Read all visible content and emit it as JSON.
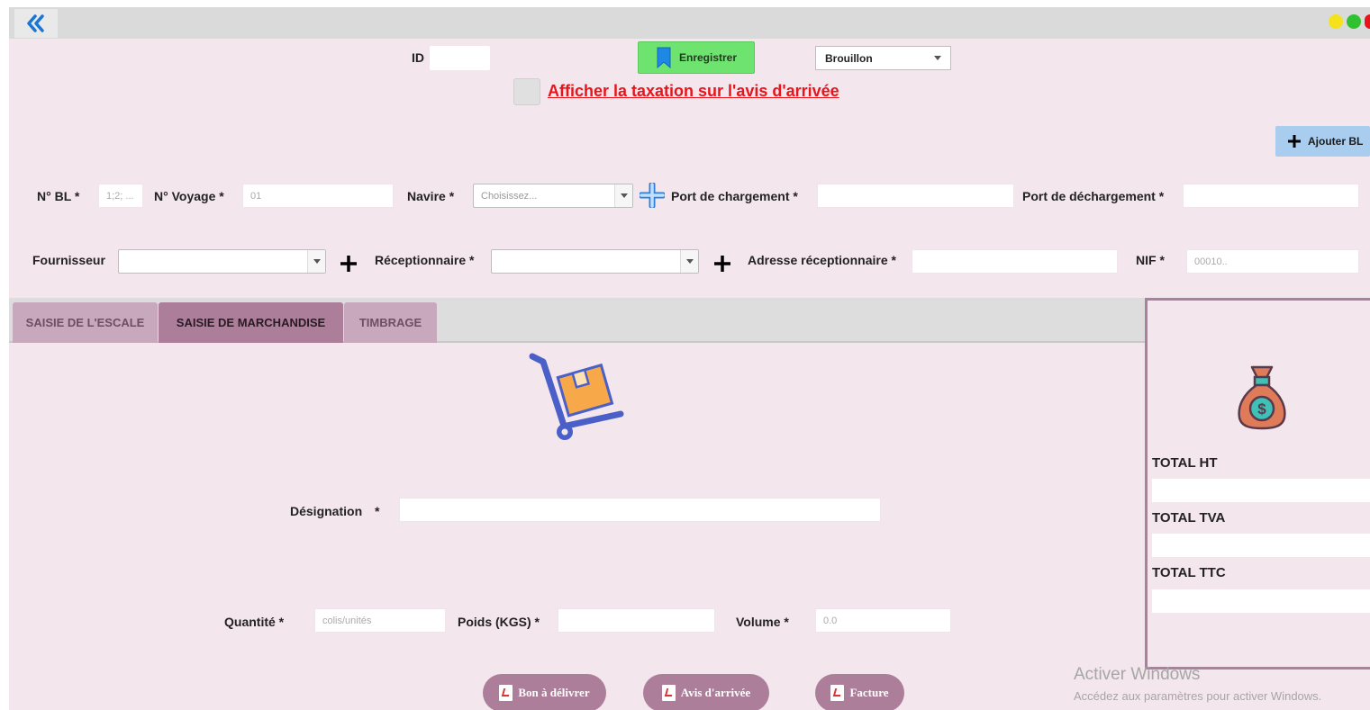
{
  "header": {
    "id_label": "ID",
    "id_value": "",
    "save_label": "Enregistrer",
    "status_value": "Brouillon",
    "tax_checkbox_label": "Afficher la taxation sur l'avis d'arrivée",
    "add_bl_label": "Ajouter BL"
  },
  "window_controls": {
    "colors": [
      "#f4e31a",
      "#2fc12f",
      "#e8141b"
    ]
  },
  "form": {
    "bl_label": "N° BL *",
    "bl_placeholder": "1;2; ...",
    "voyage_label": "N° Voyage *",
    "voyage_placeholder": "01",
    "navire_label": "Navire *",
    "navire_placeholder": "Choisissez...",
    "port_chargement_label": "Port de chargement *",
    "port_dechargement_label": "Port de déchargement *",
    "fournisseur_label": "Fournisseur",
    "receptionnaire_label": "Réceptionnaire *",
    "adresse_label": "Adresse réceptionnaire *",
    "nif_label": "NIF *",
    "nif_placeholder": "00010.."
  },
  "tabs": [
    {
      "label": "SAISIE DE L'ESCALE",
      "active": false
    },
    {
      "label": "SAISIE DE MARCHANDISE",
      "active": true
    },
    {
      "label": "TIMBRAGE",
      "active": false
    }
  ],
  "marchandise": {
    "designation_label": "Désignation",
    "designation_required": "*",
    "quantite_label": "Quantité *",
    "quantite_placeholder": "colis/unités",
    "poids_label": "Poids (KGS) *",
    "volume_label": "Volume *",
    "volume_placeholder": "0.0"
  },
  "totals": {
    "ht_label": "TOTAL HT",
    "tva_label": "TOTAL TVA",
    "ttc_label": "TOTAL TTC"
  },
  "actions": {
    "bon_label": "Bon à délivrer",
    "avis_label": "Avis d'arrivée",
    "facture_label": "Facture"
  },
  "watermark": {
    "title": "Activer Windows",
    "subtitle": "Accédez aux paramètres pour activer Windows."
  },
  "colors": {
    "panel_bg": "#f3e6ec",
    "accent_mauve": "#ad7e9a",
    "save_green": "#6fe36f",
    "link_red": "#e8141b",
    "ajouter_blue": "#a9cdee"
  }
}
